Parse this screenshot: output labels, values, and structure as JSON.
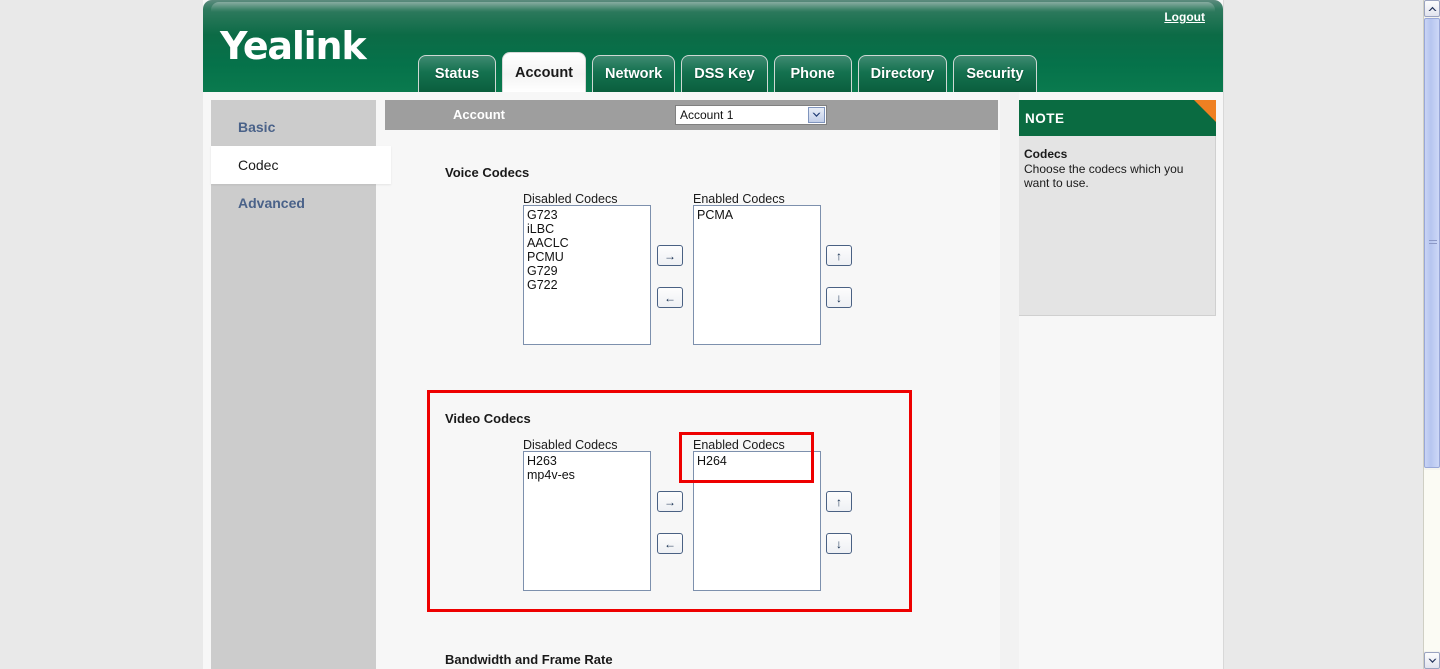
{
  "header": {
    "logo": "Yealink",
    "logout_label": "Logout",
    "tabs": [
      {
        "label": "Status",
        "active": false
      },
      {
        "label": "Account",
        "active": true
      },
      {
        "label": "Network",
        "active": false
      },
      {
        "label": "DSS Key",
        "active": false
      },
      {
        "label": "Phone",
        "active": false
      },
      {
        "label": "Directory",
        "active": false
      },
      {
        "label": "Security",
        "active": false
      }
    ]
  },
  "sidebar": {
    "items": [
      {
        "label": "Basic",
        "active": false
      },
      {
        "label": "Codec",
        "active": true
      },
      {
        "label": "Advanced",
        "active": false
      }
    ]
  },
  "account_bar": {
    "label": "Account",
    "selected": "Account 1",
    "options": [
      "Account 1"
    ],
    "dropdown_icon": "chevron-down-icon"
  },
  "voice_codecs": {
    "section_title": "Voice Codecs",
    "disabled_label": "Disabled Codecs",
    "enabled_label": "Enabled Codecs",
    "disabled_items": [
      "G723",
      "iLBC",
      "AACLC",
      "PCMU",
      "G729",
      "G722"
    ],
    "enabled_items": [
      "PCMA"
    ],
    "move_right_label": "→",
    "move_left_label": "←",
    "move_up_label": "↑",
    "move_down_label": "↓"
  },
  "video_codecs": {
    "section_title": "Video Codecs",
    "disabled_label": "Disabled Codecs",
    "enabled_label": "Enabled Codecs",
    "disabled_items": [
      "H263",
      "mp4v-es"
    ],
    "enabled_items": [
      "H264"
    ],
    "move_right_label": "→",
    "move_left_label": "←",
    "move_up_label": "↑",
    "move_down_label": "↓"
  },
  "bandwidth_section": {
    "section_title": "Bandwidth and Frame Rate"
  },
  "note": {
    "header": "NOTE",
    "title": "Codecs",
    "text": "Choose the codecs which you want to use."
  },
  "colors": {
    "brand_green": "#0a6b41",
    "accent_orange": "#ef8022",
    "highlight_red": "#ee0000",
    "sidebar_gray": "#cccccc",
    "bar_gray": "#9e9e9e"
  },
  "scrollbar": {
    "up_arrow": "▲",
    "down_arrow": "▼"
  }
}
